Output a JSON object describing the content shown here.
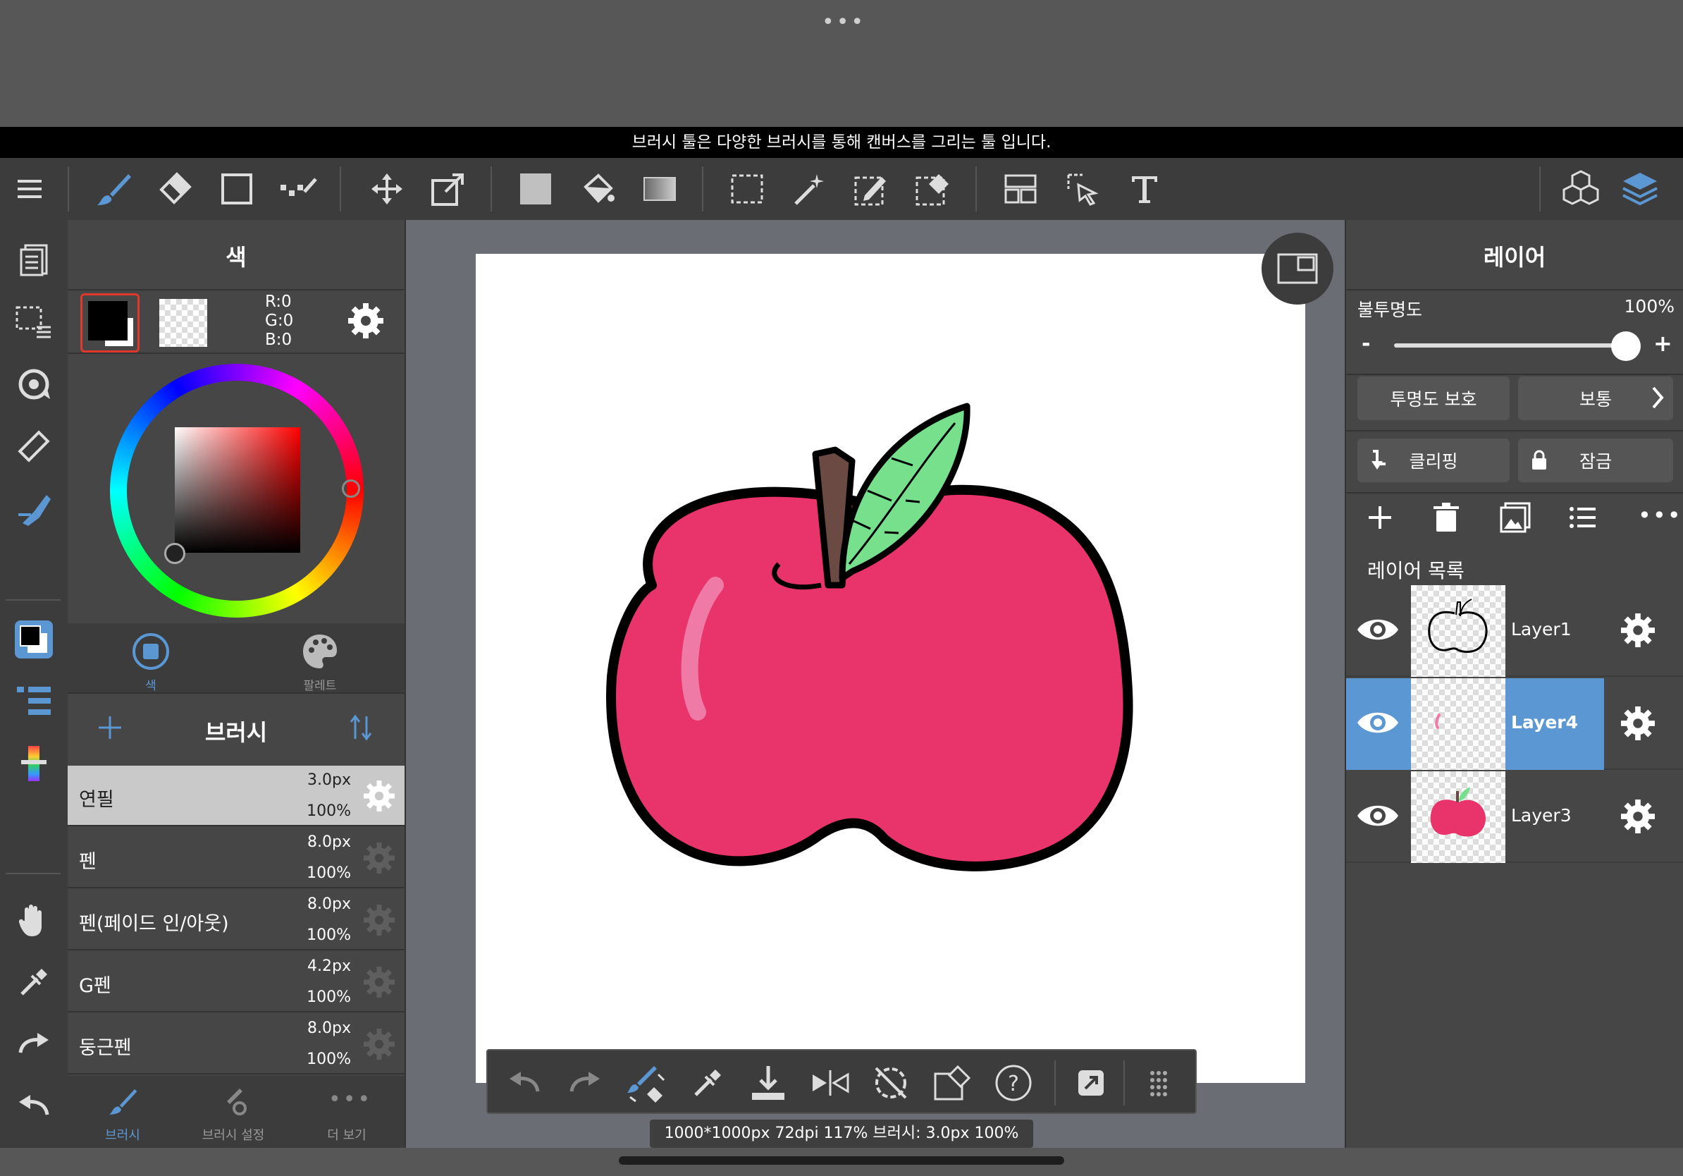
{
  "top": {
    "tooltip": "브러시 툴은 다양한 브러시를 통해 캔버스를 그리는 툴 입니다."
  },
  "toolbar_icons": [
    "menu-icon",
    "brush-icon",
    "eraser-icon",
    "shape-icon",
    "dot-brush-icon",
    "move-icon",
    "transform-icon",
    "fill-color-icon",
    "bucket-icon",
    "gradient-icon",
    "select-rect-icon",
    "magic-wand-icon",
    "select-pen-icon",
    "select-eraser-icon",
    "layout-icon",
    "select-object-icon",
    "text-icon",
    "materials-icon",
    "layers-icon"
  ],
  "color_panel": {
    "title": "색",
    "rgb": {
      "r": "R:0",
      "g": "G:0",
      "b": "B:0"
    },
    "tabs": [
      {
        "label": "색"
      },
      {
        "label": "팔레트"
      }
    ]
  },
  "brush_panel": {
    "title": "브러시",
    "brushes": [
      {
        "name": "연필",
        "size": "3.0px",
        "opacity": "100%"
      },
      {
        "name": "펜",
        "size": "8.0px",
        "opacity": "100%"
      },
      {
        "name": "펜(페이드 인/아웃)",
        "size": "8.0px",
        "opacity": "100%"
      },
      {
        "name": "G펜",
        "size": "4.2px",
        "opacity": "100%"
      },
      {
        "name": "둥근펜",
        "size": "8.0px",
        "opacity": "100%"
      }
    ],
    "tabs": [
      {
        "label": "브러시"
      },
      {
        "label": "브러시 설정"
      },
      {
        "label": "더 보기"
      }
    ]
  },
  "layer_panel": {
    "title": "레이어",
    "opacity_label": "불투명도",
    "opacity_value": "100%",
    "opacity_fraction": 1.0,
    "minus": "-",
    "plus": "+",
    "protect_alpha": "투명도 보호",
    "blend_mode": "보통",
    "clipping": "클리핑",
    "lock": "잠금",
    "list_title": "레이어 목록",
    "layers": [
      {
        "name": "Layer1",
        "selected": false
      },
      {
        "name": "Layer4",
        "selected": true
      },
      {
        "name": "Layer3",
        "selected": false
      }
    ]
  },
  "status": {
    "text": "1000*1000px 72dpi 117% 브러시: 3.0px 100%"
  },
  "colors": {
    "accent": "#5b97d2",
    "apple": "#e8336b",
    "leaf": "#77e08c",
    "stem": "#6b4a44"
  }
}
